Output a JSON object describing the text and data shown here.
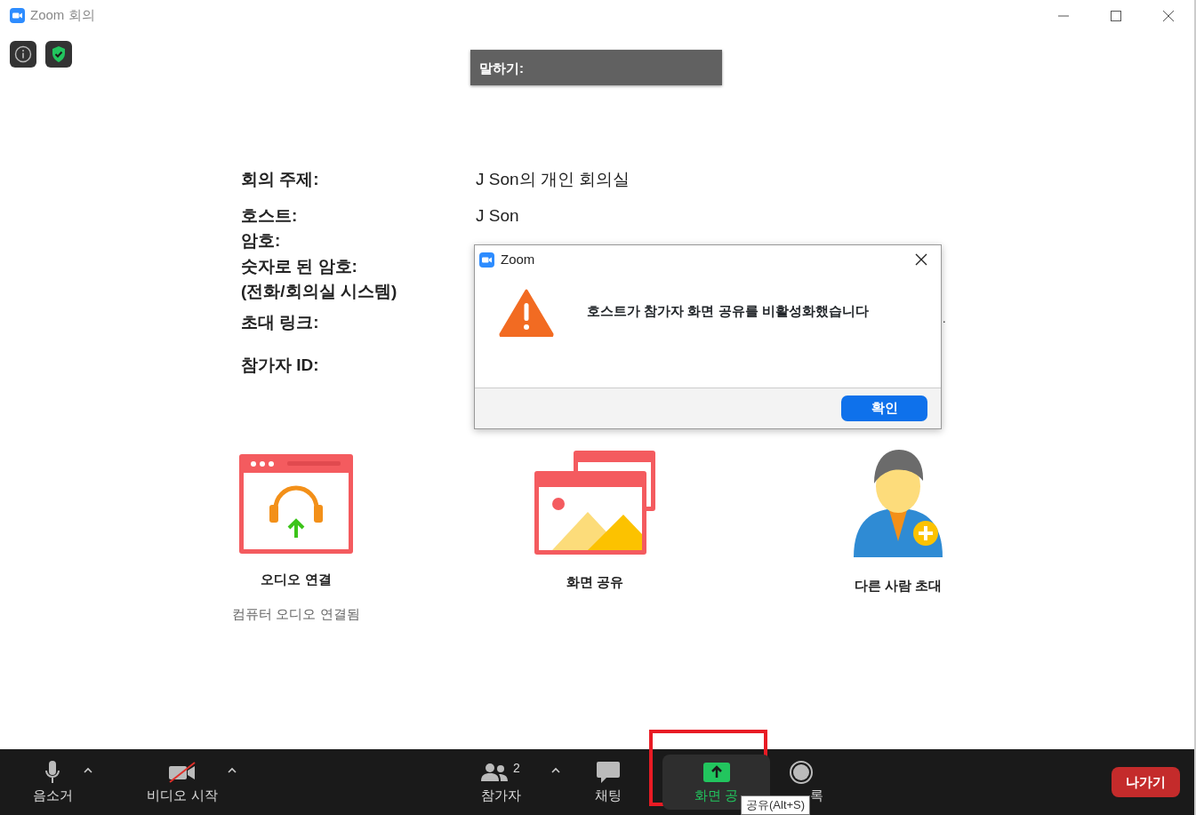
{
  "window": {
    "title": "Zoom 회의"
  },
  "speaking": {
    "label": "말하기:"
  },
  "meeting_info": [
    {
      "label": "회의 주제:",
      "value": "J Son의 개인 회의실"
    },
    {
      "label": "호스트:",
      "value": "J Son"
    },
    {
      "label": "암호:"
    },
    {
      "label": "숫자로 된 암호:",
      "note": "(전화/회의실 시스템)"
    },
    {
      "label": "초대 링크:",
      "value": "."
    },
    {
      "label": "참가자 ID:"
    }
  ],
  "actions": [
    {
      "kind": "audio",
      "label": "오디오 연결",
      "status": "컴퓨터 오디오 연결됨"
    },
    {
      "kind": "share",
      "label": "화면 공유"
    },
    {
      "kind": "invite",
      "label": "다른 사람 초대"
    }
  ],
  "dialog": {
    "title": "Zoom",
    "message": "호스트가 참가자 화면 공유를 비활성화했습니다",
    "button": "확인"
  },
  "toolbar": {
    "items": [
      {
        "kind": "mute",
        "label": "음소거",
        "caret": true,
        "selected": false,
        "highlighted": false
      },
      {
        "kind": "video",
        "label": "비디오 시작",
        "caret": true,
        "selected": false,
        "highlighted": false
      },
      {
        "kind": "participants",
        "label": "참가자",
        "count": "2",
        "caret": true,
        "selected": false,
        "highlighted": false
      },
      {
        "kind": "chat",
        "label": "채팅",
        "caret": false,
        "selected": false,
        "highlighted": false
      },
      {
        "kind": "share",
        "label": "화면 공",
        "caret": false,
        "selected": true,
        "highlighted": true
      },
      {
        "kind": "record",
        "label": "록",
        "caret": false,
        "selected": false,
        "highlighted": false
      }
    ],
    "leave": "나가기",
    "tooltip": "공유(Alt+S)"
  }
}
